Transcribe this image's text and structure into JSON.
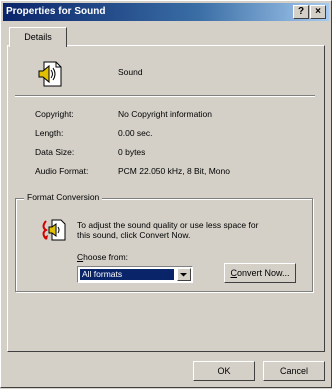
{
  "window": {
    "title": "Properties for Sound",
    "help_button": "?",
    "close_button": "×"
  },
  "tabs": [
    {
      "label": "Details"
    }
  ],
  "details": {
    "name": "Sound",
    "rows": [
      {
        "label": "Copyright:",
        "value": "No Copyright information"
      },
      {
        "label": "Length:",
        "value": "0.00 sec."
      },
      {
        "label": "Data Size:",
        "value": "0 bytes"
      },
      {
        "label": "Audio Format:",
        "value": "PCM 22.050 kHz, 8 Bit, Mono"
      }
    ]
  },
  "format_conversion": {
    "legend": "Format Conversion",
    "description_line1": "To adjust the sound quality or use less space for",
    "description_line2": "this sound, click Convert Now.",
    "choose_from_label": {
      "accel": "C",
      "rest": "hoose from:"
    },
    "choose_from_value": "All formats",
    "convert_button": {
      "accel": "C",
      "rest": "onvert Now..."
    }
  },
  "buttons": {
    "ok": "OK",
    "cancel": "Cancel"
  },
  "icon_names": [
    "speaker-file-icon",
    "convert-sound-icon",
    "help-icon",
    "close-icon",
    "dropdown-arrow-icon"
  ]
}
